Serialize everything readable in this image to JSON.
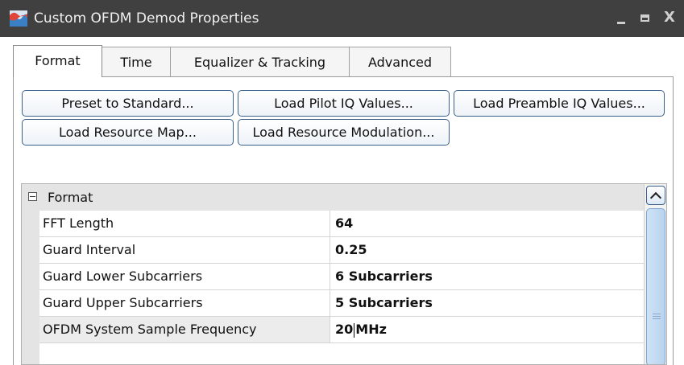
{
  "window": {
    "title": "Custom OFDM Demod Properties",
    "icon": "wave-icon",
    "controls": {
      "minimize": "–",
      "maximize": "□",
      "close": "X"
    },
    "colors": {
      "titlebar": "#404040",
      "button_border": "#3a5f8a",
      "scrollbar": "#b9d3ef"
    }
  },
  "tabs": [
    {
      "label": "Format",
      "active": true
    },
    {
      "label": "Time",
      "active": false
    },
    {
      "label": "Equalizer & Tracking",
      "active": false
    },
    {
      "label": "Advanced",
      "active": false
    }
  ],
  "buttons": {
    "preset": "Preset to Standard...",
    "load_pilot": "Load Pilot IQ Values...",
    "load_preamble": "Load Preamble IQ Values...",
    "load_resource_map": "Load Resource Map...",
    "load_resource_mod": "Load Resource Modulation..."
  },
  "grid": {
    "category": "Format",
    "rows": [
      {
        "name": "FFT Length",
        "value": "64"
      },
      {
        "name": "Guard Interval",
        "value": "0.25"
      },
      {
        "name": "Guard Lower Subcarriers",
        "value": "6 Subcarriers"
      },
      {
        "name": "Guard Upper Subcarriers",
        "value": "5 Subcarriers"
      },
      {
        "name": "OFDM System Sample Frequency",
        "value_number": "20",
        "value_unit": "MHz"
      }
    ]
  }
}
